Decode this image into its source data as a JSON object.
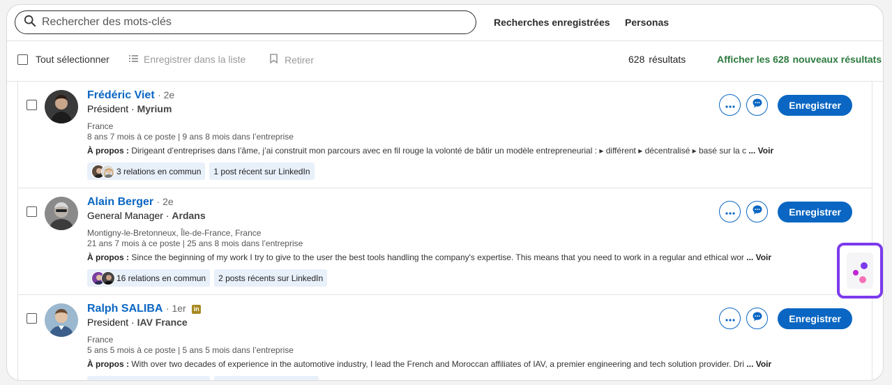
{
  "search": {
    "placeholder": "Rechercher des mots-clés"
  },
  "topnav": {
    "saved_searches": "Recherches enregistrées",
    "personas": "Personas"
  },
  "toolbar": {
    "select_all": "Tout sélectionner",
    "save_to_list": "Enregistrer dans la liste",
    "remove": "Retirer",
    "results_count": "628",
    "results_label": "résultats",
    "new_results_prefix": "Afficher les 628",
    "new_results_suffix": "nouveaux résultats"
  },
  "results": [
    {
      "name": "Frédéric Viet",
      "degree": "· 2e",
      "title": "Président",
      "company": "Myrium",
      "location": "France",
      "tenure": "8 ans 7 mois à ce poste | 9 ans 8 mois dans l’entreprise",
      "about_label": "À propos :",
      "about": "Dirigeant d’entreprises dans l’âme, j’ai construit mon parcours avec en fil rouge la volonté de bâtir un modèle entrepreneurial : ▸ différent ▸ décentralisé ▸ basé sur la c",
      "see_more": "... Voir plus",
      "connections": "3 relations en commun",
      "posts": "1 post récent sur LinkedIn",
      "save": "Enregistrer"
    },
    {
      "name": "Alain Berger",
      "degree": "· 2e",
      "title": "General Manager",
      "company": "Ardans",
      "location": "Montigny-le-Bretonneux, Île-de-France, France",
      "tenure": "21 ans 7 mois à ce poste | 25 ans 8 mois dans l’entreprise",
      "about_label": "À propos :",
      "about": "Since the beginning of my work I try to give to the user the best tools handling the company's expertise. This means that you need to work in a regular and ethical wor",
      "see_more": "... Voir plus",
      "connections": "16 relations en commun",
      "posts": "2 posts récents sur LinkedIn",
      "save": "Enregistrer"
    },
    {
      "name": "Ralph SALIBA",
      "degree": "· 1er",
      "title": "President",
      "company": "IAV France",
      "location": "France",
      "tenure": "5 ans 5 mois à ce poste | 5 ans 5 mois dans l’entreprise",
      "about_label": "À propos :",
      "about": "With over two decades of experience in the automotive industry, I lead the French and Moroccan affiliates of IAV, a premier engineering and tech solution provider. Dri",
      "see_more": "... Voir plus",
      "save": "Enregistrer"
    }
  ],
  "colors": {
    "accent": "#0a66c2",
    "success": "#2c7a3e",
    "widget_border": "#7c3aed"
  }
}
